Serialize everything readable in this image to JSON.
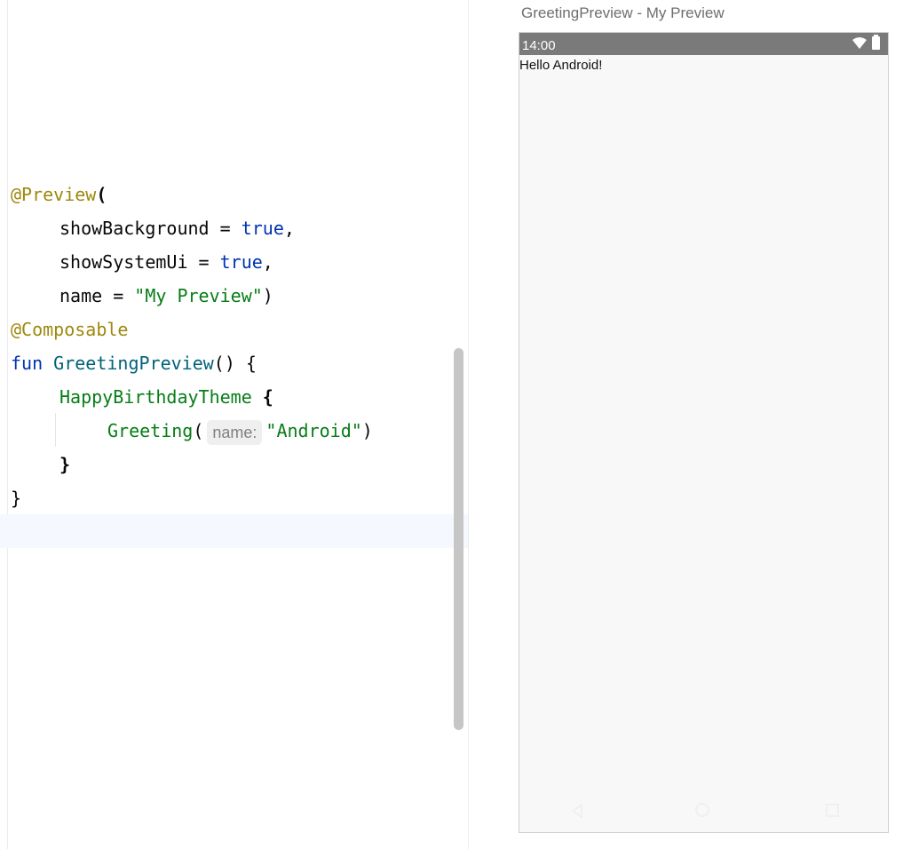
{
  "editor": {
    "code_lines": [
      {
        "annotation": "@Preview",
        "paren": "("
      },
      {
        "param": "showBackground = ",
        "value": "true",
        "suffix": ","
      },
      {
        "param": "showSystemUi = ",
        "value": "true",
        "suffix": ","
      },
      {
        "param": "name = ",
        "value": "\"My Preview\"",
        "suffix": ")"
      },
      {
        "annotation": "@Composable"
      },
      {
        "keyword": "fun ",
        "function": "GreetingPreview",
        "rest": "() {"
      },
      {
        "composable": "HappyBirthdayTheme",
        "rest": " {"
      },
      {
        "composable": "Greeting",
        "open": "(",
        "hint": "name:",
        "value": "\"Android\"",
        "close": ")"
      },
      {
        "brace": "}"
      },
      {
        "brace": "}"
      }
    ]
  },
  "preview": {
    "title": "GreetingPreview - My Preview",
    "status_time": "14:00",
    "status_icons": [
      "wifi-icon",
      "battery-icon"
    ],
    "content_text": "Hello Android!",
    "nav_icons": [
      "back-icon",
      "home-icon",
      "recents-icon"
    ],
    "colors": {
      "status_bar": "#7a7a7a",
      "screen_background": "#f8f8f8"
    }
  }
}
